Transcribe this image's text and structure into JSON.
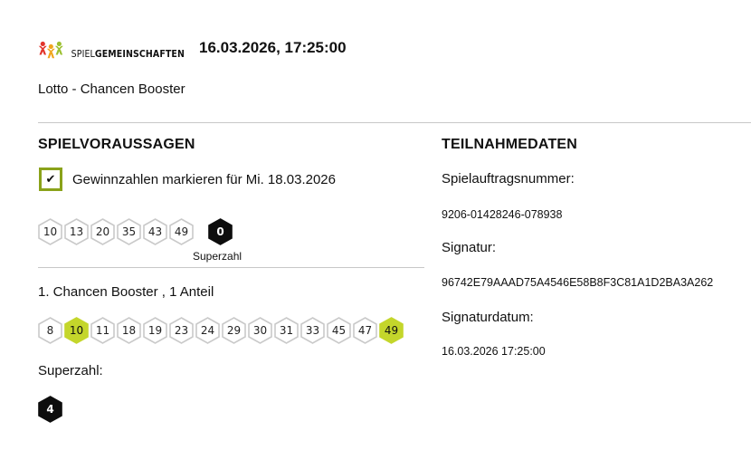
{
  "header": {
    "logo_text_thin": "SPIEL",
    "logo_text_bold": "GEMEINSCHAFTEN",
    "timestamp": "16.03.2026, 17:25:00",
    "subtitle": "Lotto - Chancen Booster"
  },
  "left": {
    "title": "SPIELVORAUSSAGEN",
    "checkbox_label": "Gewinnzahlen markieren für Mi. 18.03.2026",
    "checkbox_checked": true,
    "winning_numbers": [
      "10",
      "13",
      "20",
      "35",
      "43",
      "49"
    ],
    "superzahl": "0",
    "superzahl_caption": "Superzahl",
    "booster_title": "1. Chancen Booster , 1 Anteil",
    "booster_numbers": [
      {
        "n": "8",
        "hit": false
      },
      {
        "n": "10",
        "hit": true
      },
      {
        "n": "11",
        "hit": false
      },
      {
        "n": "18",
        "hit": false
      },
      {
        "n": "19",
        "hit": false
      },
      {
        "n": "23",
        "hit": false
      },
      {
        "n": "24",
        "hit": false
      },
      {
        "n": "29",
        "hit": false
      },
      {
        "n": "30",
        "hit": false
      },
      {
        "n": "31",
        "hit": false
      },
      {
        "n": "33",
        "hit": false
      },
      {
        "n": "45",
        "hit": false
      },
      {
        "n": "47",
        "hit": false
      },
      {
        "n": "49",
        "hit": true
      }
    ],
    "superzahl_label": "Superzahl:",
    "booster_superzahl": "4"
  },
  "right": {
    "title": "TEILNAHMEDATEN",
    "order_label": "Spielauftragsnummer:",
    "order_value": "9206-01428246-078938",
    "signature_label": "Signatur:",
    "signature_value": "96742E79AAAD75A4546E58B8F3C81A1D2BA3A262",
    "signature_date_label": "Signaturdatum:",
    "signature_date_value": "16.03.2026 17:25:00"
  },
  "colors": {
    "accent_green": "#c4d62b",
    "checkbox_border": "#8aa21a",
    "hex_border": "#c9c9c9",
    "logo_red": "#e2342b",
    "logo_orange": "#f0a51c",
    "logo_green": "#9cc031"
  }
}
